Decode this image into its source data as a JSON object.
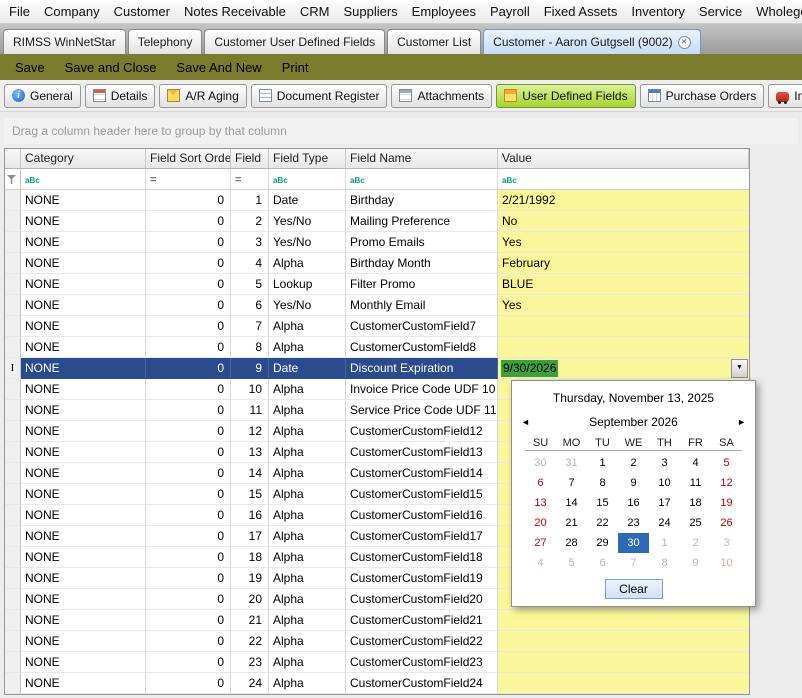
{
  "menubar": {
    "items": [
      "File",
      "Company",
      "Customer",
      "Notes Receivable",
      "CRM",
      "Suppliers",
      "Employees",
      "Payroll",
      "Fixed Assets",
      "Inventory",
      "Service",
      "Wholegoods"
    ]
  },
  "tabbar": {
    "tabs": [
      {
        "label": "RIMSS WinNetStar",
        "active": false,
        "closable": false
      },
      {
        "label": "Telephony",
        "active": false,
        "closable": false
      },
      {
        "label": "Customer User Defined Fields",
        "active": false,
        "closable": false
      },
      {
        "label": "Customer List",
        "active": false,
        "closable": false
      },
      {
        "label": "Customer - Aaron Gutgsell (9002)",
        "active": true,
        "closable": true
      }
    ]
  },
  "toolbar": {
    "buttons": [
      "Save",
      "Save and Close",
      "Save And New",
      "Print"
    ]
  },
  "subtabs": [
    {
      "label": "General",
      "icon": "general-info-icon",
      "selected": false
    },
    {
      "label": "Details",
      "icon": "details-icon",
      "selected": false
    },
    {
      "label": "A/R Aging",
      "icon": "ar-aging-icon",
      "selected": false
    },
    {
      "label": "Document Register",
      "icon": "document-register-icon",
      "selected": false
    },
    {
      "label": "Attachments",
      "icon": "attachments-icon",
      "selected": false
    },
    {
      "label": "User Defined Fields",
      "icon": "user-defined-fields-icon",
      "selected": true
    },
    {
      "label": "Purchase Orders",
      "icon": "purchase-orders-icon",
      "selected": false
    },
    {
      "label": "Insurance",
      "icon": "insurance-icon",
      "selected": false
    }
  ],
  "grid": {
    "group_hint": "Drag a column header here to group by that column",
    "columns": [
      "Category",
      "Field Sort Order",
      "Field",
      "Field Type",
      "Field Name",
      "Value"
    ],
    "filter_types": [
      "text",
      "numeric",
      "numeric",
      "text",
      "text",
      "text"
    ],
    "selected_row_index": 8,
    "editor": {
      "value": "9/30/2026"
    },
    "rows": [
      {
        "category": "NONE",
        "sort_order": "0",
        "field": "1",
        "field_type": "Date",
        "field_name": "Birthday",
        "value": "2/21/1992"
      },
      {
        "category": "NONE",
        "sort_order": "0",
        "field": "2",
        "field_type": "Yes/No",
        "field_name": "Mailing Preference",
        "value": "No"
      },
      {
        "category": "NONE",
        "sort_order": "0",
        "field": "3",
        "field_type": "Yes/No",
        "field_name": "Promo Emails",
        "value": "Yes"
      },
      {
        "category": "NONE",
        "sort_order": "0",
        "field": "4",
        "field_type": "Alpha",
        "field_name": "Birthday Month",
        "value": "February"
      },
      {
        "category": "NONE",
        "sort_order": "0",
        "field": "5",
        "field_type": "Lookup",
        "field_name": "Filter Promo",
        "value": "BLUE"
      },
      {
        "category": "NONE",
        "sort_order": "0",
        "field": "6",
        "field_type": "Yes/No",
        "field_name": "Monthly Email",
        "value": "Yes"
      },
      {
        "category": "NONE",
        "sort_order": "0",
        "field": "7",
        "field_type": "Alpha",
        "field_name": "CustomerCustomField7",
        "value": ""
      },
      {
        "category": "NONE",
        "sort_order": "0",
        "field": "8",
        "field_type": "Alpha",
        "field_name": "CustomerCustomField8",
        "value": ""
      },
      {
        "category": "NONE",
        "sort_order": "0",
        "field": "9",
        "field_type": "Date",
        "field_name": "Discount Expiration",
        "value": ""
      },
      {
        "category": "NONE",
        "sort_order": "0",
        "field": "10",
        "field_type": "Alpha",
        "field_name": "Invoice Price Code UDF 10",
        "value": ""
      },
      {
        "category": "NONE",
        "sort_order": "0",
        "field": "11",
        "field_type": "Alpha",
        "field_name": "Service Price Code UDF 11",
        "value": ""
      },
      {
        "category": "NONE",
        "sort_order": "0",
        "field": "12",
        "field_type": "Alpha",
        "field_name": "CustomerCustomField12",
        "value": ""
      },
      {
        "category": "NONE",
        "sort_order": "0",
        "field": "13",
        "field_type": "Alpha",
        "field_name": "CustomerCustomField13",
        "value": ""
      },
      {
        "category": "NONE",
        "sort_order": "0",
        "field": "14",
        "field_type": "Alpha",
        "field_name": "CustomerCustomField14",
        "value": ""
      },
      {
        "category": "NONE",
        "sort_order": "0",
        "field": "15",
        "field_type": "Alpha",
        "field_name": "CustomerCustomField15",
        "value": ""
      },
      {
        "category": "NONE",
        "sort_order": "0",
        "field": "16",
        "field_type": "Alpha",
        "field_name": "CustomerCustomField16",
        "value": ""
      },
      {
        "category": "NONE",
        "sort_order": "0",
        "field": "17",
        "field_type": "Alpha",
        "field_name": "CustomerCustomField17",
        "value": ""
      },
      {
        "category": "NONE",
        "sort_order": "0",
        "field": "18",
        "field_type": "Alpha",
        "field_name": "CustomerCustomField18",
        "value": ""
      },
      {
        "category": "NONE",
        "sort_order": "0",
        "field": "19",
        "field_type": "Alpha",
        "field_name": "CustomerCustomField19",
        "value": ""
      },
      {
        "category": "NONE",
        "sort_order": "0",
        "field": "20",
        "field_type": "Alpha",
        "field_name": "CustomerCustomField20",
        "value": ""
      },
      {
        "category": "NONE",
        "sort_order": "0",
        "field": "21",
        "field_type": "Alpha",
        "field_name": "CustomerCustomField21",
        "value": ""
      },
      {
        "category": "NONE",
        "sort_order": "0",
        "field": "22",
        "field_type": "Alpha",
        "field_name": "CustomerCustomField22",
        "value": ""
      },
      {
        "category": "NONE",
        "sort_order": "0",
        "field": "23",
        "field_type": "Alpha",
        "field_name": "CustomerCustomField23",
        "value": ""
      },
      {
        "category": "NONE",
        "sort_order": "0",
        "field": "24",
        "field_type": "Alpha",
        "field_name": "CustomerCustomField24",
        "value": ""
      }
    ]
  },
  "calendar": {
    "today_label": "Thursday, November 13, 2025",
    "month_label": "September 2026",
    "day_headers": [
      "SU",
      "MO",
      "TU",
      "WE",
      "TH",
      "FR",
      "SA"
    ],
    "selected_day": "30",
    "clear_label": "Clear",
    "weeks": [
      [
        {
          "d": "30",
          "t": "om"
        },
        {
          "d": "31",
          "t": "om"
        },
        {
          "d": "1",
          "t": ""
        },
        {
          "d": "2",
          "t": ""
        },
        {
          "d": "3",
          "t": ""
        },
        {
          "d": "4",
          "t": ""
        },
        {
          "d": "5",
          "t": "we"
        }
      ],
      [
        {
          "d": "6",
          "t": "we"
        },
        {
          "d": "7",
          "t": ""
        },
        {
          "d": "8",
          "t": ""
        },
        {
          "d": "9",
          "t": ""
        },
        {
          "d": "10",
          "t": ""
        },
        {
          "d": "11",
          "t": ""
        },
        {
          "d": "12",
          "t": "we"
        }
      ],
      [
        {
          "d": "13",
          "t": "we"
        },
        {
          "d": "14",
          "t": ""
        },
        {
          "d": "15",
          "t": ""
        },
        {
          "d": "16",
          "t": ""
        },
        {
          "d": "17",
          "t": ""
        },
        {
          "d": "18",
          "t": ""
        },
        {
          "d": "19",
          "t": "we"
        }
      ],
      [
        {
          "d": "20",
          "t": "we"
        },
        {
          "d": "21",
          "t": ""
        },
        {
          "d": "22",
          "t": ""
        },
        {
          "d": "23",
          "t": ""
        },
        {
          "d": "24",
          "t": ""
        },
        {
          "d": "25",
          "t": ""
        },
        {
          "d": "26",
          "t": "we"
        }
      ],
      [
        {
          "d": "27",
          "t": "we"
        },
        {
          "d": "28",
          "t": ""
        },
        {
          "d": "29",
          "t": ""
        },
        {
          "d": "30",
          "t": "sel"
        },
        {
          "d": "1",
          "t": "om"
        },
        {
          "d": "2",
          "t": "om"
        },
        {
          "d": "3",
          "t": "omwe"
        }
      ],
      [
        {
          "d": "4",
          "t": "omwe"
        },
        {
          "d": "5",
          "t": "om"
        },
        {
          "d": "6",
          "t": "om"
        },
        {
          "d": "7",
          "t": "om"
        },
        {
          "d": "8",
          "t": "om"
        },
        {
          "d": "9",
          "t": "om"
        },
        {
          "d": "10",
          "t": "omwe"
        }
      ]
    ]
  },
  "icons": {
    "close": "✕",
    "dropdown": "▼",
    "prev_arrow": "◄",
    "next_arrow": "►",
    "text_filter": "aBc",
    "equals_filter": "=",
    "edit_indicator": "I"
  },
  "colors": {
    "toolbar_olive": "#7B7B2E",
    "active_tab_blue": "#C6DCF6",
    "selected_subtab_green": "#A5D42E",
    "value_cell_yellow": "#FBF69C",
    "selected_row_blue": "#2A4B8C",
    "editor_selection_green": "#3AA13D",
    "weekend_red": "#C00000",
    "selected_day_blue": "#2D6AB4"
  }
}
